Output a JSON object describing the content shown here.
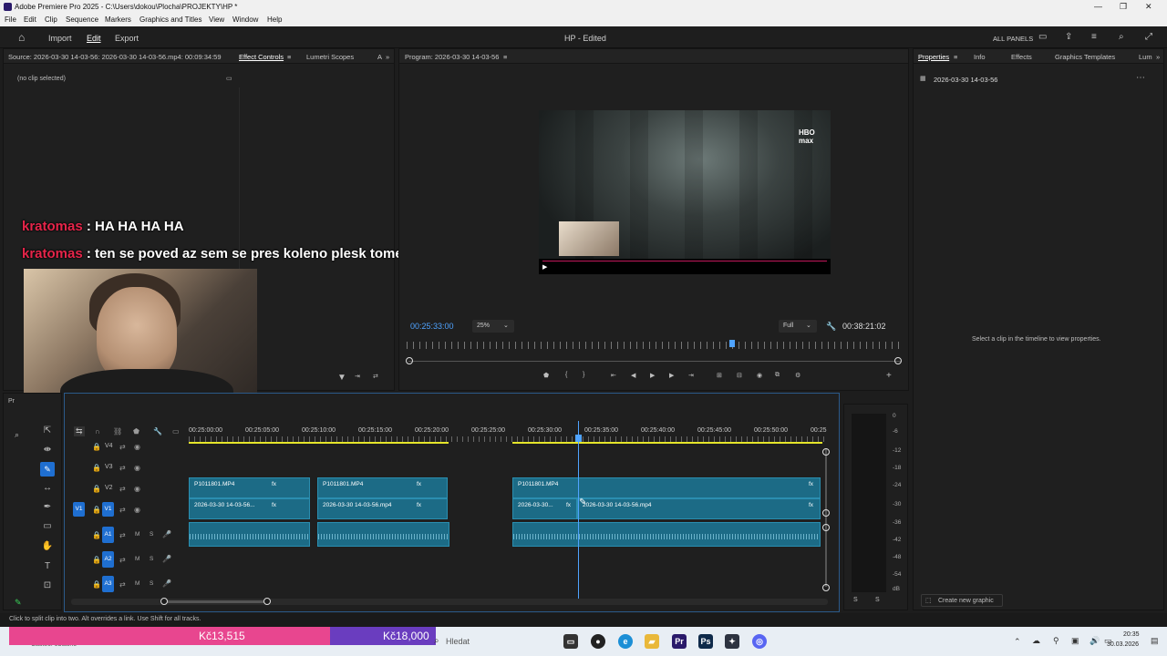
{
  "window": {
    "title": "Adobe Premiere Pro 2025 - C:\\Users\\dokou\\Plocha\\PROJEKTY\\HP *"
  },
  "menu": [
    "File",
    "Edit",
    "Clip",
    "Sequence",
    "Markers",
    "Graphics and Titles",
    "View",
    "Window",
    "Help"
  ],
  "appbar": {
    "import": "Import",
    "edit": "Edit",
    "export": "Export",
    "project_title": "HP - Edited",
    "all_panels": "ALL PANELS"
  },
  "source_panel": {
    "source_label": "Source: 2026-03-30 14-03-56: 2026-03-30 14-03-56.mp4: 00:09:34:59",
    "effect_controls": "Effect Controls",
    "lumetri_scopes": "Lumetri Scopes",
    "more_tab": "A",
    "no_clip": "(no clip selected)"
  },
  "program_panel": {
    "title": "Program: 2026-03-30 14-03-56",
    "timecode": "00:25:33:00",
    "zoom": "25%",
    "quality": "Full",
    "duration": "00:38:21:02",
    "hbo_logo": "HBO max"
  },
  "properties_panel": {
    "tabs": [
      "Properties",
      "Info",
      "Effects",
      "Graphics Templates",
      "Lum"
    ],
    "sequence_name": "2026-03-30 14-03-56",
    "empty_message": "Select a clip in the timeline to view properties.",
    "create_graphic": "Create new graphic"
  },
  "chat_overlay": [
    {
      "user": "kratomas",
      "message": " : HA HA HA HA"
    },
    {
      "user": "kratomas",
      "message": " : ten se poved az sem se pres koleno plesk tome"
    }
  ],
  "timeline": {
    "ruler": [
      "00:25:00:00",
      "00:25:05:00",
      "00:25:10:00",
      "00:25:15:00",
      "00:25:20:00",
      "00:25:25:00",
      "00:25:30:00",
      "00:25:35:00",
      "00:25:40:00",
      "00:25:45:00",
      "00:25:50:00",
      "00:25"
    ],
    "tracks_video": [
      {
        "name": "V4"
      },
      {
        "name": "V3"
      },
      {
        "name": "V2"
      },
      {
        "name": "V1",
        "target": "V1"
      }
    ],
    "tracks_audio": [
      {
        "name": "A1",
        "target": "A1"
      },
      {
        "name": "A2"
      },
      {
        "name": "A3"
      }
    ],
    "clips_v2": [
      {
        "label": "P1011801.MP4",
        "fx": "fx"
      },
      {
        "label": "P1011801.MP4",
        "fx": "fx"
      },
      {
        "label": "P1011801.MP4",
        "fx": "fx"
      }
    ],
    "clips_v1": [
      {
        "label": "2026-03-30 14-03-56...",
        "fx": "fx"
      },
      {
        "label": "2026-03-30 14-03-56.mp4",
        "fx": "fx"
      },
      {
        "label": "2026-03-30...",
        "fx": "fx"
      },
      {
        "label": "2026-03-30 14-03-56.mp4",
        "fx": "fx"
      }
    ],
    "track_letters": {
      "m": "M",
      "s": "S"
    },
    "panel_tab": "Pr"
  },
  "audio_meter": {
    "labels": [
      "0",
      "-6",
      "-12",
      "-18",
      "-24",
      "-30",
      "-36",
      "-42",
      "-48",
      "-54",
      "dB"
    ],
    "footer": [
      "S",
      "S"
    ]
  },
  "status_bar": {
    "hint": "Click to split clip into two. Alt overrides a link. Use Shift for all tracks."
  },
  "taskbar": {
    "weather": "Částeč. oblačno",
    "donation_left": "Kč13,515",
    "donation_right": "Kč18,000",
    "search_placeholder": "Hledat",
    "time": "20:35",
    "date": "30.03.2026"
  },
  "colors": {
    "accent": "#1f6fd1",
    "clip": "#1c6b86",
    "chat_user": "#e6254a",
    "donation_pink": "#e8468f",
    "donation_purple": "#6a3dbf"
  }
}
